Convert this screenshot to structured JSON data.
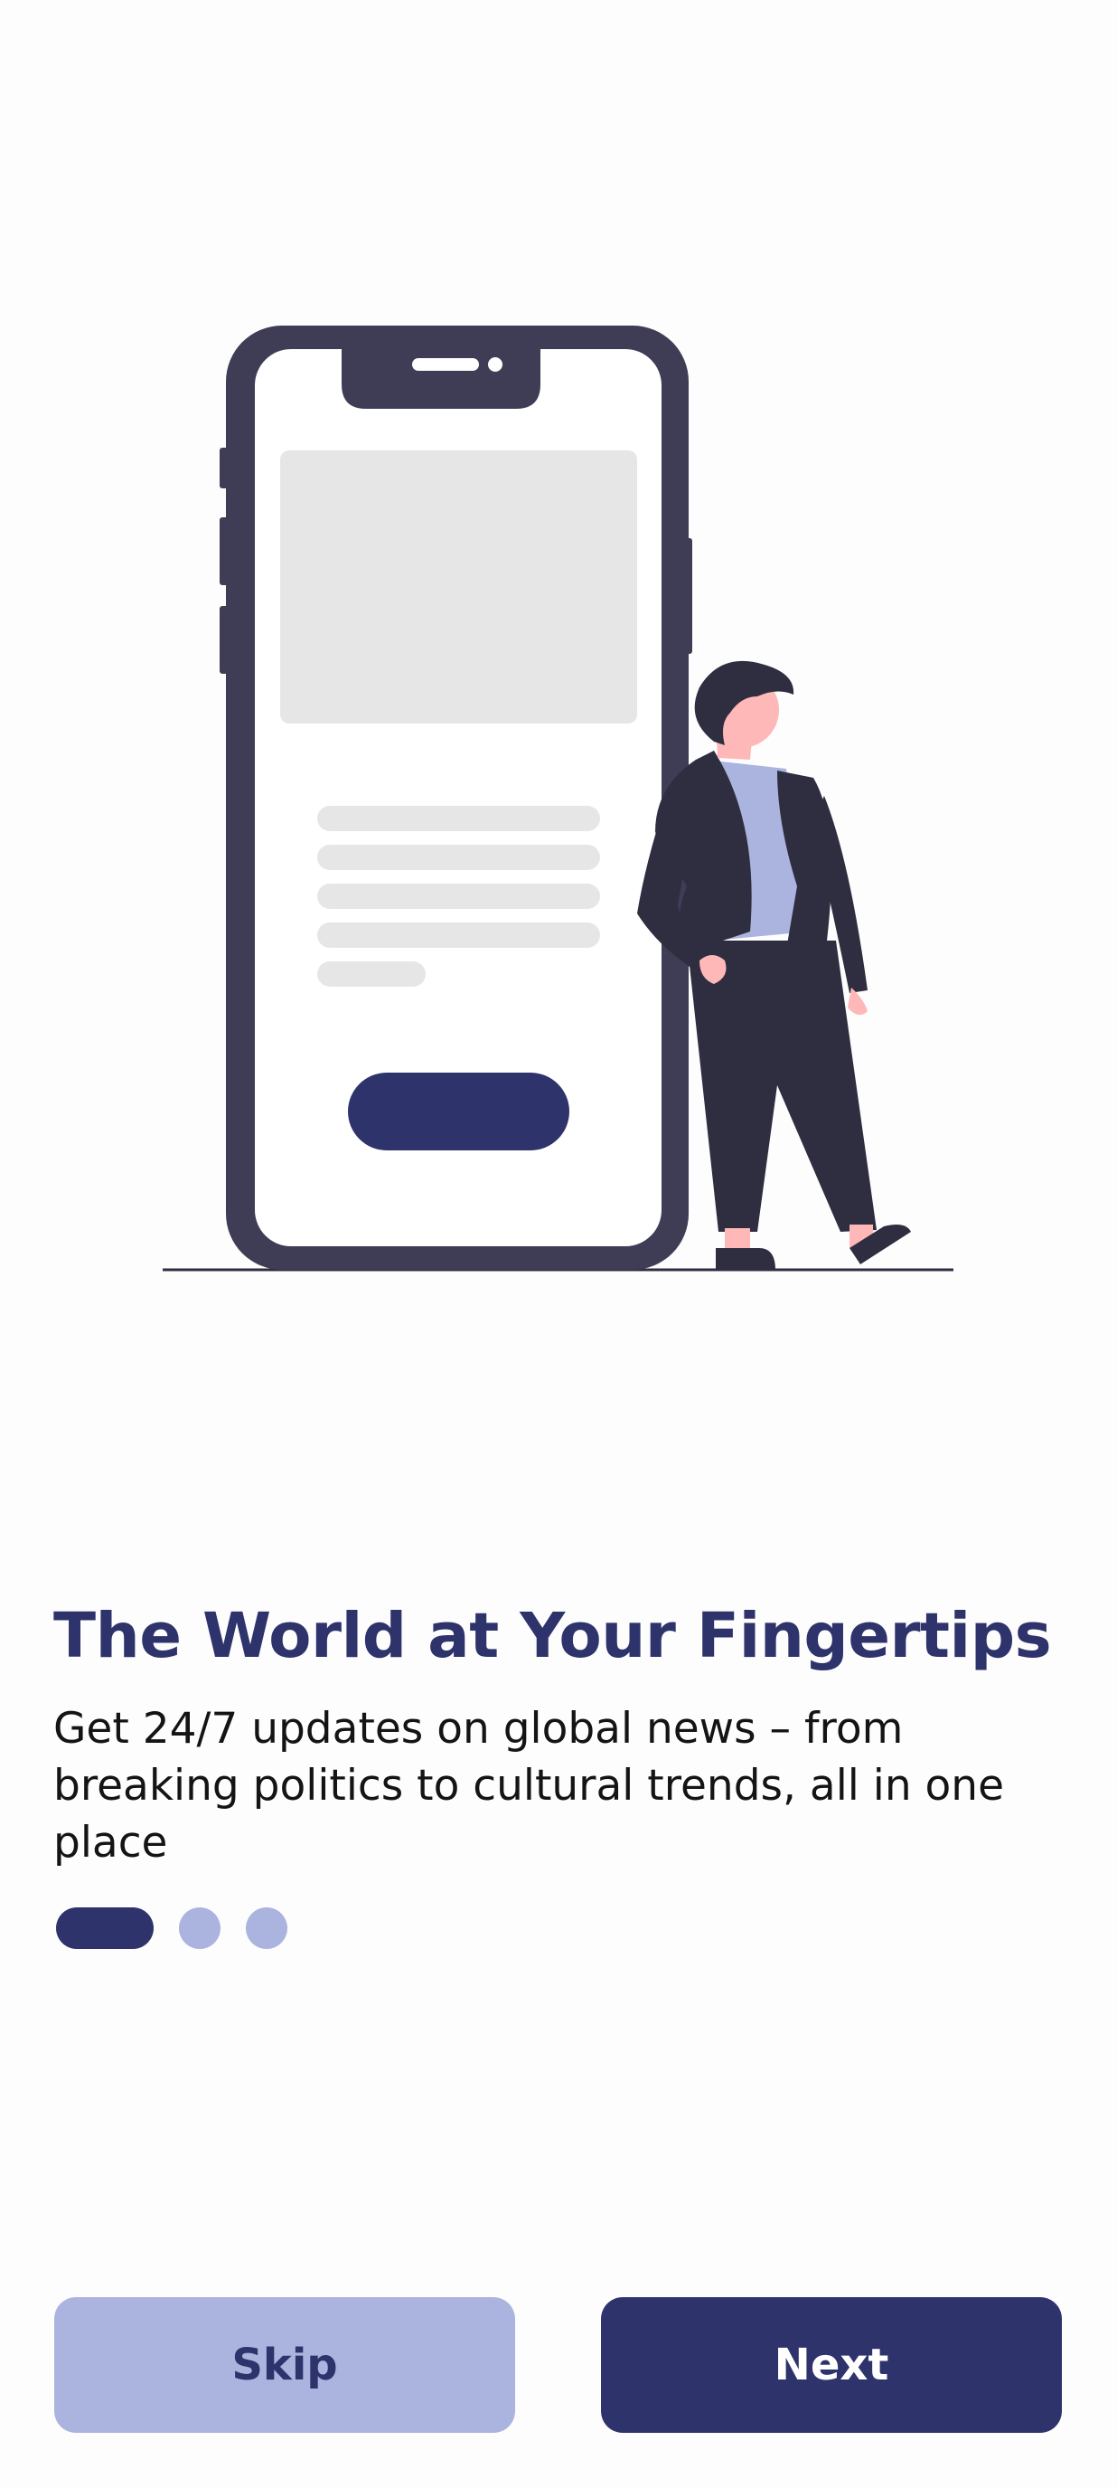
{
  "onboarding": {
    "title": "The World at Your Fingertips",
    "description": "Get 24/7 updates on global news – from breaking politics to cultural trends, all in one place",
    "pagination": {
      "total_pages": 3,
      "current_page": 1
    },
    "skip_label": "Skip",
    "next_label": "Next"
  },
  "colors": {
    "primary": "#2e336b",
    "secondary": "#aab4de",
    "background": "#fdfdfd",
    "text": "#141414"
  }
}
